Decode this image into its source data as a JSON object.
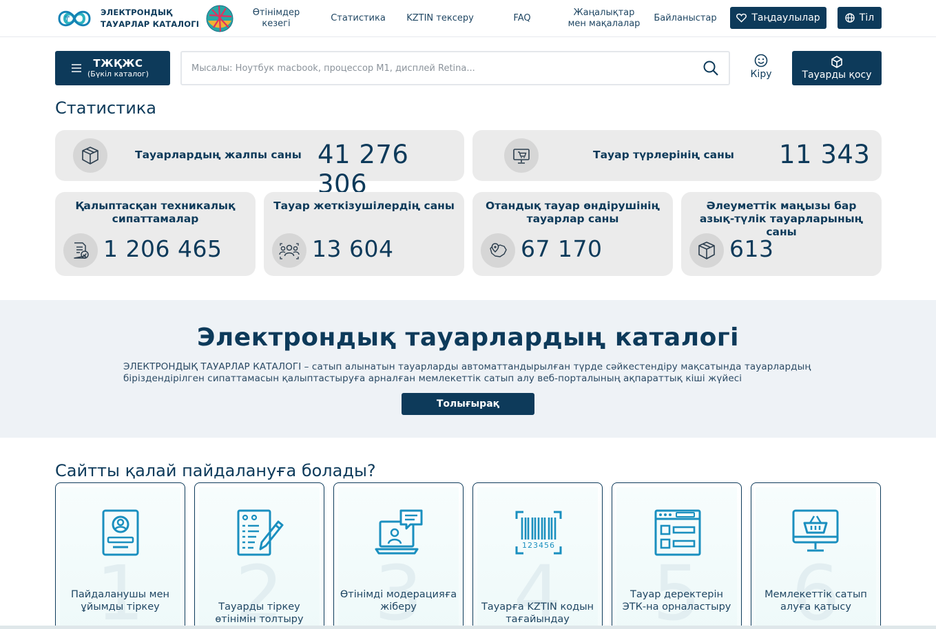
{
  "header": {
    "logo_text": "ЭЛЕКТРОНДЫҚ ТАУАРЛАР КАТАЛОГІ",
    "nav": [
      {
        "label": "Өтінімдер кезегі"
      },
      {
        "label": "Статистика"
      },
      {
        "label": "KZTIN тексеру"
      },
      {
        "label": "FAQ"
      },
      {
        "label": "Жаңалықтар мен мақалалар"
      },
      {
        "label": "Байланыстар"
      }
    ],
    "favorites_label": "Таңдаулылар",
    "language_label": "Тіл"
  },
  "search_row": {
    "catalog_main": "ТЖҚЖС",
    "catalog_sub": "(Бүкіл каталог)",
    "search_placeholder": "Мысалы: Ноутбук macbook, процессор M1, дисплей Retina...",
    "login_label": "Кіру",
    "add_product_label": "Тауарды қосу"
  },
  "statistics": {
    "title": "Статистика",
    "wide": [
      {
        "label": "Тауарлардың жалпы саны",
        "value": "41 276 306",
        "icon": "box-icon"
      },
      {
        "label": "Тауар түрлерінің саны",
        "value": "11 343",
        "icon": "monitor-cart-icon"
      }
    ],
    "small": [
      {
        "label": "Қалыптасқан техникалық сипаттамалар",
        "value": "1 206 465",
        "icon": "document-check-icon"
      },
      {
        "label": "Тауар жеткізушілердің саны",
        "value": "13 604",
        "icon": "users-group-icon"
      },
      {
        "label": "Отандық тауар өндірушінің тауарлар саны",
        "value": "67 170",
        "icon": "map-pin-icon"
      },
      {
        "label": "Әлеуметтік маңызы бар азық-түлік тауарларының саны",
        "value": "613",
        "icon": "box-icon"
      }
    ]
  },
  "banner": {
    "title": "Электрондық тауарлардың каталогі",
    "description": "ЭЛЕКТРОНДЫҚ ТАУАРЛАР КАТАЛОГІ – сатып алынатын тауарларды автоматтандырылған түрде сәйкестендіру мақсатында тауарлардың біріздендірілген сипаттамасын қалыптастыруға арналған мемлекеттік сатып алу веб-порталының ақпараттық кіші жүйесі",
    "button_label": "Толығырақ"
  },
  "how_to": {
    "title": "Сайтты қалай пайдалануға болады?",
    "steps": [
      {
        "number": "1",
        "label": "Пайдаланушы мен ұйымды тіркеу",
        "icon": "user-card-icon"
      },
      {
        "number": "2",
        "label": "Тауарды тіркеу өтінімін толтыру",
        "icon": "form-pencil-icon"
      },
      {
        "number": "3",
        "label": "Өтінімді модерацияға жіберу",
        "icon": "laptop-chat-icon"
      },
      {
        "number": "4",
        "label": "Тауарға KZTIN кодын тағайындау",
        "icon": "barcode-icon"
      },
      {
        "number": "5",
        "label": "Тауар деректерін ЭТК-на орналастыру",
        "icon": "browser-window-icon"
      },
      {
        "number": "6",
        "label": "Мемлекеттік сатып алуға қатысу",
        "icon": "monitor-basket-icon"
      }
    ]
  },
  "colors": {
    "primary": "#0d3a5a",
    "card_bg": "#ebebeb",
    "banner_bg": "#eef2f6",
    "icon_accent": "#1a8fbf"
  }
}
